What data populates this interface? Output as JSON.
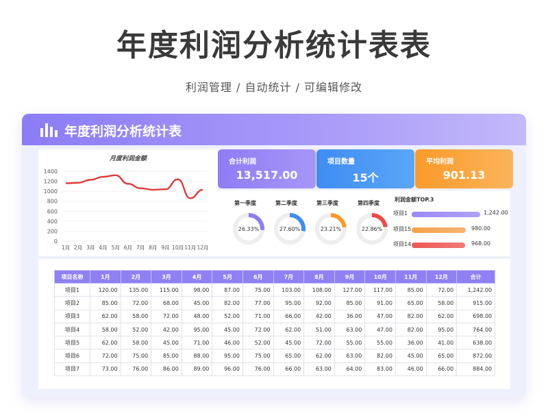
{
  "title": "年度利润分析统计表表",
  "subtitle": "利润管理 / 自动统计 / 可编辑修改",
  "card": {
    "header_title": "年度利润分析统计表"
  },
  "chart_data": {
    "type": "line",
    "title": "月度利润金额",
    "categories": [
      "1月",
      "2月",
      "3月",
      "4月",
      "5月",
      "6月",
      "7月",
      "8月",
      "9月",
      "10月",
      "11月",
      "12月"
    ],
    "values": [
      1160,
      1170,
      1230,
      1290,
      1320,
      1150,
      1060,
      1030,
      1040,
      1240,
      860,
      1030
    ],
    "yticks": [
      "1400",
      "1200",
      "1000",
      "800",
      "600",
      "400",
      "200",
      "0"
    ],
    "ylim": [
      0,
      1400
    ],
    "color": "#e03a3a"
  },
  "kpis": [
    {
      "label": "合计利润",
      "value": "13,517.00"
    },
    {
      "label": "项目数量",
      "value": "15个"
    },
    {
      "label": "平均利润",
      "value": "901.13"
    }
  ],
  "quarters": [
    {
      "label": "第一季度",
      "percent": "26.33%",
      "fraction": 0.2633,
      "color": "#8b7cf6"
    },
    {
      "label": "第二季度",
      "percent": "27.60%",
      "fraction": 0.276,
      "color": "#3f8cf3"
    },
    {
      "label": "第三季度",
      "percent": "23.21%",
      "fraction": 0.2321,
      "color": "#fb9a2a"
    },
    {
      "label": "第四季度",
      "percent": "22.86%",
      "fraction": 0.2286,
      "color": "#ef4a4a"
    }
  ],
  "top3": {
    "title": "利润金额TOP.3",
    "max": 1242,
    "items": [
      {
        "name": "项目1",
        "value": "1,242.00",
        "amount": 1242,
        "color": "#9b8af7"
      },
      {
        "name": "项目15",
        "value": "980.00",
        "amount": 980,
        "color": "#f5a14a"
      },
      {
        "name": "项目14",
        "value": "968.00",
        "amount": 968,
        "color": "#ee5757"
      }
    ]
  },
  "table": {
    "headers": [
      "项目名称",
      "1月",
      "2月",
      "3月",
      "4月",
      "5月",
      "6月",
      "7月",
      "8月",
      "9月",
      "10月",
      "11月",
      "12月",
      "合计"
    ],
    "rows": [
      [
        "项目1",
        "120.00",
        "135.00",
        "115.00",
        "98.00",
        "87.00",
        "75.00",
        "103.00",
        "108.00",
        "127.00",
        "117.00",
        "85.00",
        "72.00",
        "1,242.00"
      ],
      [
        "项目2",
        "85.00",
        "72.00",
        "68.00",
        "45.00",
        "82.00",
        "77.00",
        "95.00",
        "92.00",
        "85.00",
        "91.00",
        "65.00",
        "58.00",
        "915.00"
      ],
      [
        "项目3",
        "62.00",
        "58.00",
        "72.00",
        "48.00",
        "52.00",
        "71.00",
        "66.00",
        "42.00",
        "36.00",
        "47.00",
        "82.00",
        "62.00",
        "698.00"
      ],
      [
        "项目4",
        "58.00",
        "52.00",
        "42.00",
        "95.00",
        "45.00",
        "72.00",
        "62.00",
        "51.00",
        "63.00",
        "47.00",
        "82.00",
        "95.00",
        "764.00"
      ],
      [
        "项目5",
        "62.00",
        "58.00",
        "45.00",
        "71.00",
        "46.00",
        "52.00",
        "45.00",
        "72.00",
        "55.00",
        "55.00",
        "36.00",
        "41.00",
        "638.00"
      ],
      [
        "项目6",
        "72.00",
        "75.00",
        "85.00",
        "88.00",
        "95.00",
        "75.00",
        "65.00",
        "62.00",
        "63.00",
        "82.00",
        "45.00",
        "65.00",
        "872.00"
      ],
      [
        "项目7",
        "73.00",
        "76.00",
        "86.00",
        "89.00",
        "96.00",
        "76.00",
        "66.00",
        "63.00",
        "64.00",
        "83.00",
        "46.00",
        "66.00",
        "884.00"
      ]
    ]
  }
}
